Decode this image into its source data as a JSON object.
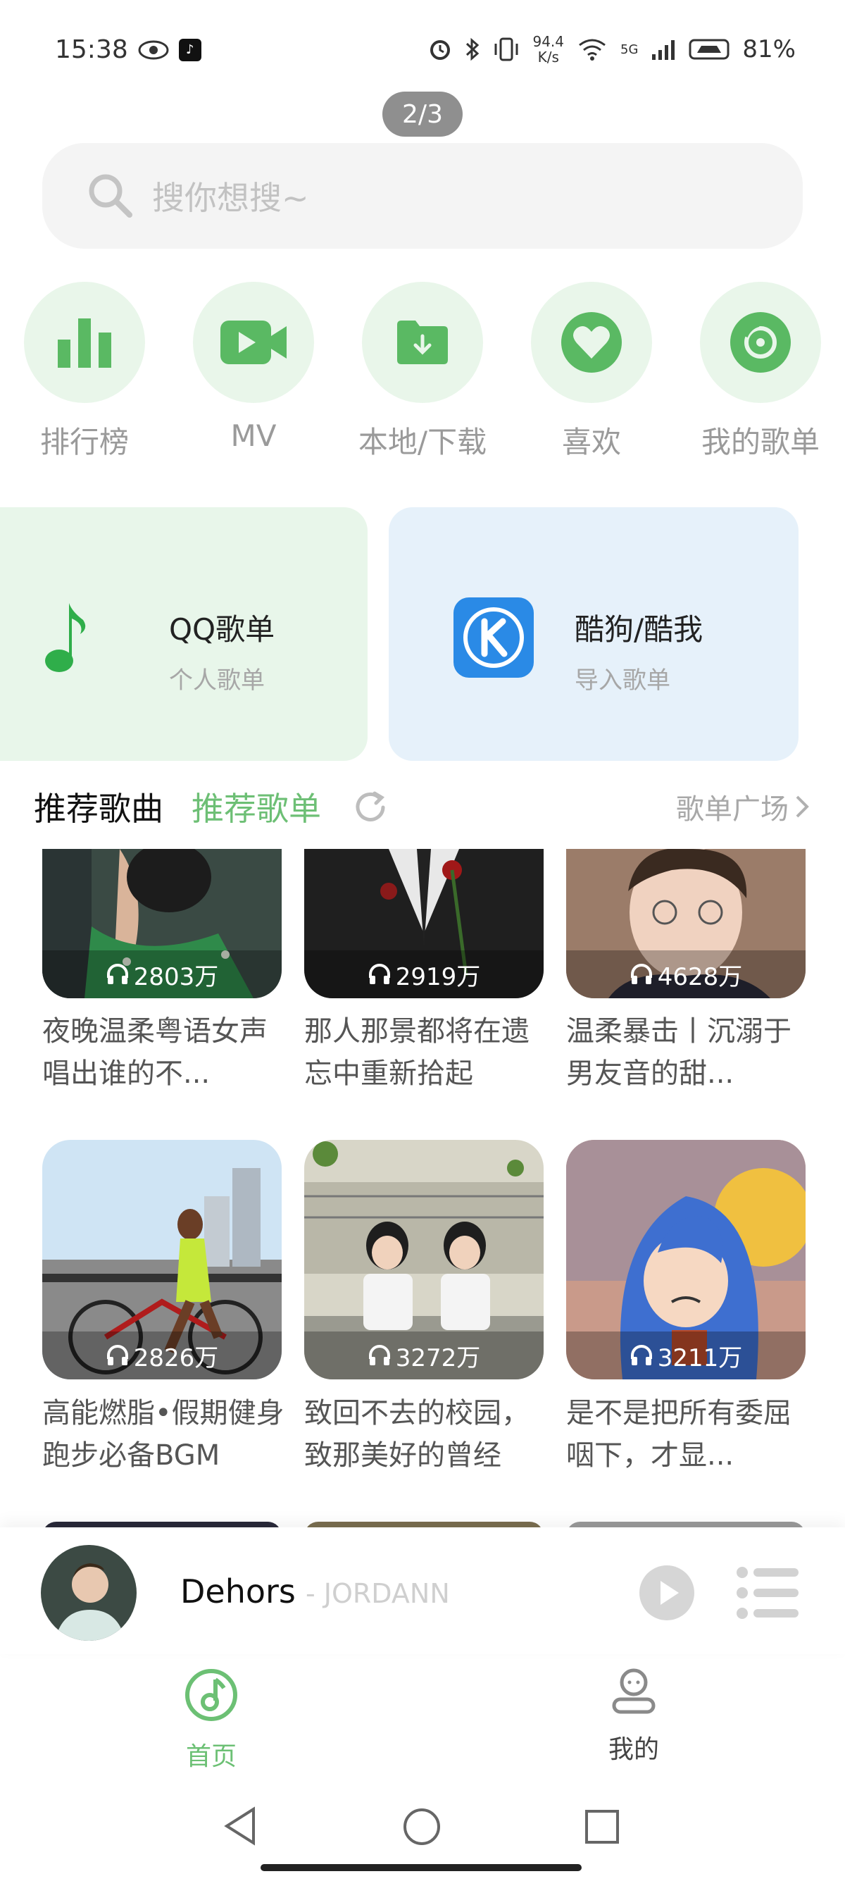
{
  "status_bar": {
    "time": "15:38",
    "net_speed_value": "94.4",
    "net_speed_unit": "K/s",
    "signal": "5G",
    "battery": "81%"
  },
  "page_indicator": "2/3",
  "search": {
    "placeholder": "搜你想搜~"
  },
  "quick_nav": [
    {
      "label": "排行榜",
      "icon": "chart-icon"
    },
    {
      "label": "MV",
      "icon": "video-icon"
    },
    {
      "label": "本地/下载",
      "icon": "download-folder-icon"
    },
    {
      "label": "喜欢",
      "icon": "heart-icon"
    },
    {
      "label": "我的歌单",
      "icon": "disc-icon"
    }
  ],
  "import_cards": [
    {
      "title": "QQ歌单",
      "subtitle": "个人歌单",
      "icon": "qq-music-note-icon"
    },
    {
      "title": "酷狗/酷我",
      "subtitle": "导入歌单",
      "icon": "kugou-k-icon"
    }
  ],
  "section": {
    "active_tab": "推荐歌曲",
    "tab": "推荐歌单",
    "plaza_link": "歌单广场"
  },
  "playlists": [
    {
      "plays": "2803万",
      "name": "夜晚温柔粤语女声 唱出谁的不..."
    },
    {
      "plays": "2919万",
      "name": "那人那景都将在遗忘中重新拾起"
    },
    {
      "plays": "4628万",
      "name": "温柔暴击丨沉溺于男友音的甜..."
    },
    {
      "plays": "2826万",
      "name": "高能燃脂•假期健身跑步必备BGM"
    },
    {
      "plays": "3272万",
      "name": "致回不去的校园，致那美好的曾经"
    },
    {
      "plays": "3211万",
      "name": "是不是把所有委屈咽下，才显..."
    }
  ],
  "mini_player": {
    "song": "Dehors",
    "artist": "- JORDANN"
  },
  "bottom_nav": [
    {
      "label": "首页",
      "icon": "home-music-icon",
      "active": true
    },
    {
      "label": "我的",
      "icon": "profile-icon",
      "active": false
    }
  ],
  "colors": {
    "accent": "#5ab963",
    "accent_light": "#e9f6ea",
    "kugou_blue": "#2a8ae6",
    "card_blue": "#e6f1fa"
  }
}
